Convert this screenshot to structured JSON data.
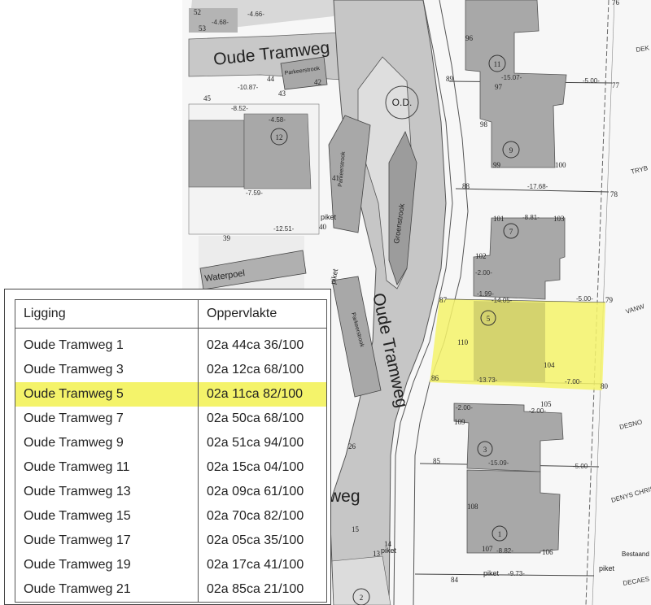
{
  "map": {
    "street_labels": {
      "top": "Oude Tramweg",
      "vertical": "Oude Tramweg",
      "bottom_partial": "weg"
    },
    "area_labels": {
      "parkeerstrook_top": "Parkeerstrook",
      "parkeerstrook_mid": "Parkeerstrook",
      "parkeerstrook_low": "Parkeerstrook",
      "groenstrook": "Groenstrook",
      "waterpoel": "Waterpoel",
      "od": "O.D.",
      "bestaand": "Bestaand"
    },
    "lot_circles": [
      "11",
      "9",
      "7",
      "5",
      "3",
      "1",
      "12",
      "2"
    ],
    "piket_labels": [
      "piket",
      "piket",
      "piket",
      "piket",
      "piket"
    ],
    "edge_labels": [
      "DEK",
      "TRYB",
      "VANW",
      "DESNO",
      "DENYS CHRIS",
      "DECAES"
    ],
    "point_numbers": [
      "96",
      "97",
      "98",
      "99",
      "100",
      "89",
      "77",
      "88",
      "78",
      "101",
      "102",
      "103",
      "87",
      "79",
      "110",
      "104",
      "86",
      "80",
      "105",
      "109",
      "85",
      "108",
      "107",
      "106",
      "84",
      "52",
      "53",
      "45",
      "44",
      "43",
      "42",
      "41",
      "40",
      "39",
      "26",
      "15",
      "14",
      "13",
      "76"
    ],
    "dimensions": [
      "-15.07-",
      "-5.00-",
      "-17.68-",
      "-8.81-",
      "-14.05-",
      "-5.00-",
      "-13.73-",
      "-7.00-",
      "-15.09-",
      "-5.00-",
      "-8.82-",
      "-9.73-",
      "-12.51-",
      "-7.59-",
      "-10.87-",
      "-8.52-",
      "-4.58-",
      "-4.68-",
      "-4.66-",
      "-2.00-",
      "-2.00-",
      "-2.00-",
      "-1.99-"
    ]
  },
  "table": {
    "headers": [
      "Ligging",
      "Oppervlakte"
    ],
    "rows": [
      {
        "ligging": "Oude Tramweg 1",
        "oppervlakte": "02a 44ca 36/100"
      },
      {
        "ligging": "Oude Tramweg 3",
        "oppervlakte": "02a 12ca 68/100"
      },
      {
        "ligging": "Oude Tramweg 5",
        "oppervlakte": "02a 11ca 82/100"
      },
      {
        "ligging": "Oude Tramweg 7",
        "oppervlakte": "02a 50ca 68/100"
      },
      {
        "ligging": "Oude Tramweg 9",
        "oppervlakte": "02a 51ca 94/100"
      },
      {
        "ligging": "Oude Tramweg 11",
        "oppervlakte": "02a 15ca 04/100"
      },
      {
        "ligging": "Oude Tramweg 13",
        "oppervlakte": "02a 09ca 61/100"
      },
      {
        "ligging": "Oude Tramweg 15",
        "oppervlakte": "02a 70ca 82/100"
      },
      {
        "ligging": "Oude Tramweg 17",
        "oppervlakte": "02a 05ca 35/100"
      },
      {
        "ligging": "Oude Tramweg 19",
        "oppervlakte": "02a 17ca 41/100"
      },
      {
        "ligging": "Oude Tramweg 21",
        "oppervlakte": "02a 85ca 21/100"
      }
    ],
    "highlight_row": "Oude Tramweg 5"
  },
  "colors": {
    "highlight": "#f4f36a",
    "building": "#a8a8a8",
    "road": "#c6c6c6",
    "road_edge": "#555555"
  }
}
